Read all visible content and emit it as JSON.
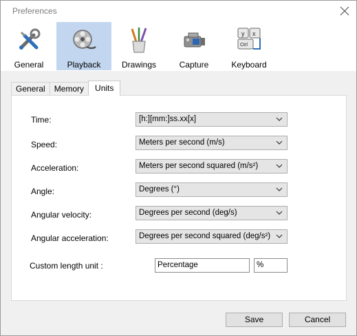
{
  "window": {
    "title": "Preferences"
  },
  "toolbar": {
    "items": [
      {
        "label": "General",
        "icon": "tools-icon"
      },
      {
        "label": "Playback",
        "icon": "film-reel-icon",
        "active": true
      },
      {
        "label": "Drawings",
        "icon": "brushes-icon"
      },
      {
        "label": "Capture",
        "icon": "camera-icon"
      },
      {
        "label": "Keyboard",
        "icon": "keyboard-keys-icon"
      }
    ]
  },
  "tabs": [
    {
      "label": "General"
    },
    {
      "label": "Memory"
    },
    {
      "label": "Units",
      "active": true
    }
  ],
  "units": {
    "time": {
      "label": "Time:",
      "value": "[h:][mm:]ss.xx[x]"
    },
    "speed": {
      "label": "Speed:",
      "value": "Meters per second (m/s)"
    },
    "acceleration": {
      "label": "Acceleration:",
      "value": "Meters per second squared (m/s²)"
    },
    "angle": {
      "label": "Angle:",
      "value": "Degrees (°)"
    },
    "angular_velocity": {
      "label": "Angular velocity:",
      "value": "Degrees per second (deg/s)"
    },
    "angular_acceleration": {
      "label": "Angular acceleration:",
      "value": "Degrees per second squared (deg/s²)"
    },
    "custom_length": {
      "label": "Custom length unit :",
      "name_value": "Percentage",
      "symbol_value": "%"
    }
  },
  "buttons": {
    "save": "Save",
    "cancel": "Cancel"
  },
  "colors": {
    "active_toolbar_bg": "#c3d6ef",
    "panel_bg": "#ffffff",
    "window_bg": "#f0f0f0"
  }
}
